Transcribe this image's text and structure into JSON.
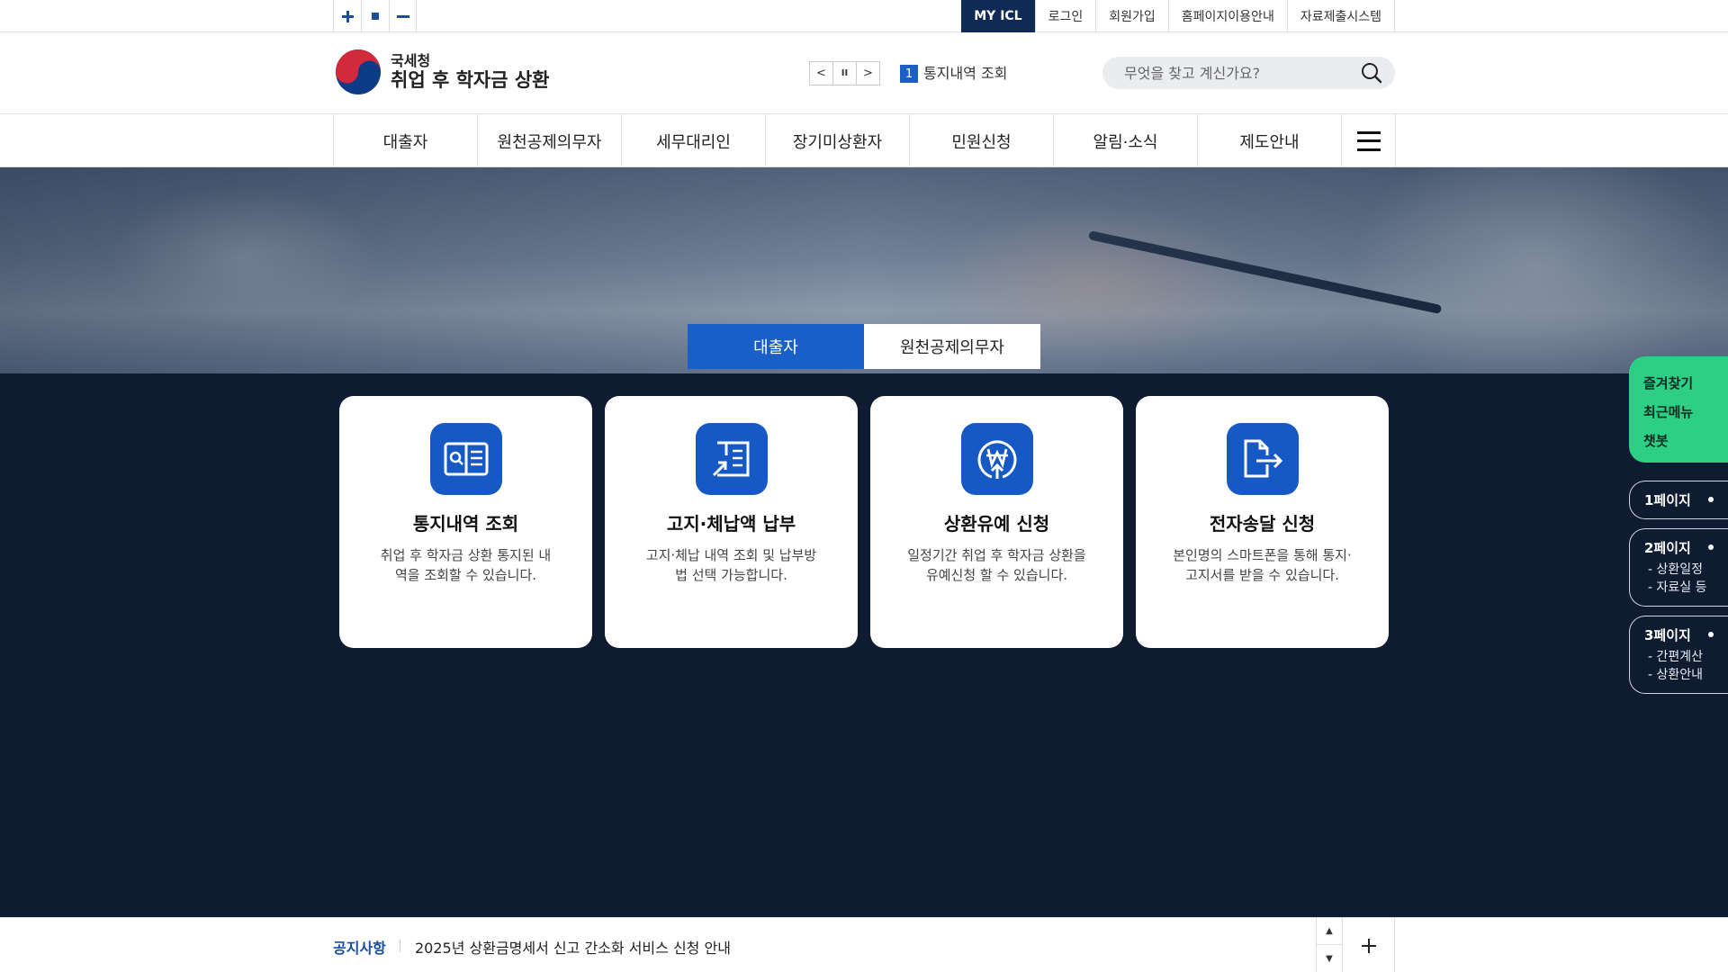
{
  "topbar": {
    "zoom": {
      "in_icon": "plus-icon",
      "reset_icon": "square-icon",
      "out_icon": "minus-icon"
    },
    "links": [
      "MY ICL",
      "로그인",
      "회원가입",
      "홈페이지이용안내",
      "자료제출시스템"
    ]
  },
  "header": {
    "logo_org": "국세청",
    "logo_name": "취업 후 학자금 상환",
    "notice_ctrls": [
      "<",
      "II",
      ">"
    ],
    "notice_num": "1",
    "notice_label": "통지내역 조회",
    "search_placeholder": "무엇을 찾고 계신가요?"
  },
  "nav": {
    "items": [
      "대출자",
      "원천공제의무자",
      "세무대리인",
      "장기미상환자",
      "민원신청",
      "알림·소식",
      "제도안내"
    ]
  },
  "hero": {
    "tabs": [
      "대출자",
      "원천공제의무자"
    ]
  },
  "cards": [
    {
      "title": "통지내역 조회",
      "desc": "취업 후 학자금 상환 통지된 내역을 조회할 수 있습니다.",
      "icon": "document-search-icon"
    },
    {
      "title": "고지·체납액 납부",
      "desc": "고지·체납 내역 조회 및 납부방법 선택 가능합니다.",
      "icon": "book-payment-icon"
    },
    {
      "title": "상환유예 신청",
      "desc": "일정기간 취업 후 학자금 상환을 유예신청 할 수 있습니다.",
      "icon": "won-coin-icon"
    },
    {
      "title": "전자송달 신청",
      "desc": "본인명의 스마트폰을 통해 통지·고지서를 받을 수 있습니다.",
      "icon": "file-export-icon"
    }
  ],
  "quick": [
    "즐겨찾기",
    "최근메뉴",
    "챗봇"
  ],
  "pages": [
    {
      "title": "1페이지",
      "subs": []
    },
    {
      "title": "2페이지",
      "subs": [
        "- 상환일정",
        "- 자료실 등"
      ]
    },
    {
      "title": "3페이지",
      "subs": [
        "- 간편계산",
        "- 상환안내"
      ]
    }
  ],
  "notice_bar": {
    "label": "공지사항",
    "text": "2025년 상환금명세서 신고 간소화 서비스 신청 안내",
    "up": "▲",
    "down": "▼"
  }
}
